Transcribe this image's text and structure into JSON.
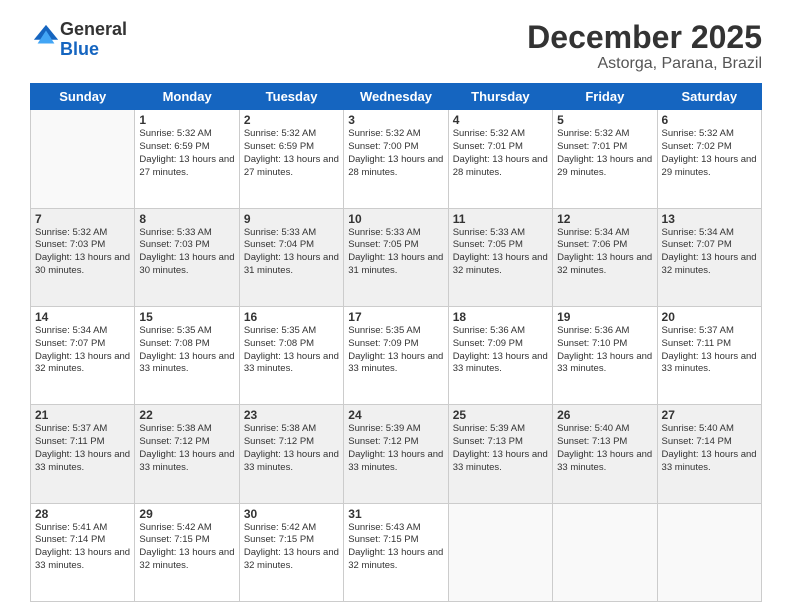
{
  "logo": {
    "general": "General",
    "blue": "Blue"
  },
  "header": {
    "month": "December 2025",
    "location": "Astorga, Parana, Brazil"
  },
  "weekdays": [
    "Sunday",
    "Monday",
    "Tuesday",
    "Wednesday",
    "Thursday",
    "Friday",
    "Saturday"
  ],
  "weeks": [
    [
      {
        "day": "",
        "rise": "",
        "set": "",
        "daylight": "",
        "empty": true
      },
      {
        "day": "1",
        "rise": "Sunrise: 5:32 AM",
        "set": "Sunset: 6:59 PM",
        "daylight": "Daylight: 13 hours and 27 minutes."
      },
      {
        "day": "2",
        "rise": "Sunrise: 5:32 AM",
        "set": "Sunset: 6:59 PM",
        "daylight": "Daylight: 13 hours and 27 minutes."
      },
      {
        "day": "3",
        "rise": "Sunrise: 5:32 AM",
        "set": "Sunset: 7:00 PM",
        "daylight": "Daylight: 13 hours and 28 minutes."
      },
      {
        "day": "4",
        "rise": "Sunrise: 5:32 AM",
        "set": "Sunset: 7:01 PM",
        "daylight": "Daylight: 13 hours and 28 minutes."
      },
      {
        "day": "5",
        "rise": "Sunrise: 5:32 AM",
        "set": "Sunset: 7:01 PM",
        "daylight": "Daylight: 13 hours and 29 minutes."
      },
      {
        "day": "6",
        "rise": "Sunrise: 5:32 AM",
        "set": "Sunset: 7:02 PM",
        "daylight": "Daylight: 13 hours and 29 minutes."
      }
    ],
    [
      {
        "day": "7",
        "rise": "Sunrise: 5:32 AM",
        "set": "Sunset: 7:03 PM",
        "daylight": "Daylight: 13 hours and 30 minutes."
      },
      {
        "day": "8",
        "rise": "Sunrise: 5:33 AM",
        "set": "Sunset: 7:03 PM",
        "daylight": "Daylight: 13 hours and 30 minutes."
      },
      {
        "day": "9",
        "rise": "Sunrise: 5:33 AM",
        "set": "Sunset: 7:04 PM",
        "daylight": "Daylight: 13 hours and 31 minutes."
      },
      {
        "day": "10",
        "rise": "Sunrise: 5:33 AM",
        "set": "Sunset: 7:05 PM",
        "daylight": "Daylight: 13 hours and 31 minutes."
      },
      {
        "day": "11",
        "rise": "Sunrise: 5:33 AM",
        "set": "Sunset: 7:05 PM",
        "daylight": "Daylight: 13 hours and 32 minutes."
      },
      {
        "day": "12",
        "rise": "Sunrise: 5:34 AM",
        "set": "Sunset: 7:06 PM",
        "daylight": "Daylight: 13 hours and 32 minutes."
      },
      {
        "day": "13",
        "rise": "Sunrise: 5:34 AM",
        "set": "Sunset: 7:07 PM",
        "daylight": "Daylight: 13 hours and 32 minutes."
      }
    ],
    [
      {
        "day": "14",
        "rise": "Sunrise: 5:34 AM",
        "set": "Sunset: 7:07 PM",
        "daylight": "Daylight: 13 hours and 32 minutes."
      },
      {
        "day": "15",
        "rise": "Sunrise: 5:35 AM",
        "set": "Sunset: 7:08 PM",
        "daylight": "Daylight: 13 hours and 33 minutes."
      },
      {
        "day": "16",
        "rise": "Sunrise: 5:35 AM",
        "set": "Sunset: 7:08 PM",
        "daylight": "Daylight: 13 hours and 33 minutes."
      },
      {
        "day": "17",
        "rise": "Sunrise: 5:35 AM",
        "set": "Sunset: 7:09 PM",
        "daylight": "Daylight: 13 hours and 33 minutes."
      },
      {
        "day": "18",
        "rise": "Sunrise: 5:36 AM",
        "set": "Sunset: 7:09 PM",
        "daylight": "Daylight: 13 hours and 33 minutes."
      },
      {
        "day": "19",
        "rise": "Sunrise: 5:36 AM",
        "set": "Sunset: 7:10 PM",
        "daylight": "Daylight: 13 hours and 33 minutes."
      },
      {
        "day": "20",
        "rise": "Sunrise: 5:37 AM",
        "set": "Sunset: 7:11 PM",
        "daylight": "Daylight: 13 hours and 33 minutes."
      }
    ],
    [
      {
        "day": "21",
        "rise": "Sunrise: 5:37 AM",
        "set": "Sunset: 7:11 PM",
        "daylight": "Daylight: 13 hours and 33 minutes."
      },
      {
        "day": "22",
        "rise": "Sunrise: 5:38 AM",
        "set": "Sunset: 7:12 PM",
        "daylight": "Daylight: 13 hours and 33 minutes."
      },
      {
        "day": "23",
        "rise": "Sunrise: 5:38 AM",
        "set": "Sunset: 7:12 PM",
        "daylight": "Daylight: 13 hours and 33 minutes."
      },
      {
        "day": "24",
        "rise": "Sunrise: 5:39 AM",
        "set": "Sunset: 7:12 PM",
        "daylight": "Daylight: 13 hours and 33 minutes."
      },
      {
        "day": "25",
        "rise": "Sunrise: 5:39 AM",
        "set": "Sunset: 7:13 PM",
        "daylight": "Daylight: 13 hours and 33 minutes."
      },
      {
        "day": "26",
        "rise": "Sunrise: 5:40 AM",
        "set": "Sunset: 7:13 PM",
        "daylight": "Daylight: 13 hours and 33 minutes."
      },
      {
        "day": "27",
        "rise": "Sunrise: 5:40 AM",
        "set": "Sunset: 7:14 PM",
        "daylight": "Daylight: 13 hours and 33 minutes."
      }
    ],
    [
      {
        "day": "28",
        "rise": "Sunrise: 5:41 AM",
        "set": "Sunset: 7:14 PM",
        "daylight": "Daylight: 13 hours and 33 minutes."
      },
      {
        "day": "29",
        "rise": "Sunrise: 5:42 AM",
        "set": "Sunset: 7:15 PM",
        "daylight": "Daylight: 13 hours and 32 minutes."
      },
      {
        "day": "30",
        "rise": "Sunrise: 5:42 AM",
        "set": "Sunset: 7:15 PM",
        "daylight": "Daylight: 13 hours and 32 minutes."
      },
      {
        "day": "31",
        "rise": "Sunrise: 5:43 AM",
        "set": "Sunset: 7:15 PM",
        "daylight": "Daylight: 13 hours and 32 minutes."
      },
      {
        "day": "",
        "rise": "",
        "set": "",
        "daylight": "",
        "empty": true
      },
      {
        "day": "",
        "rise": "",
        "set": "",
        "daylight": "",
        "empty": true
      },
      {
        "day": "",
        "rise": "",
        "set": "",
        "daylight": "",
        "empty": true
      }
    ]
  ]
}
